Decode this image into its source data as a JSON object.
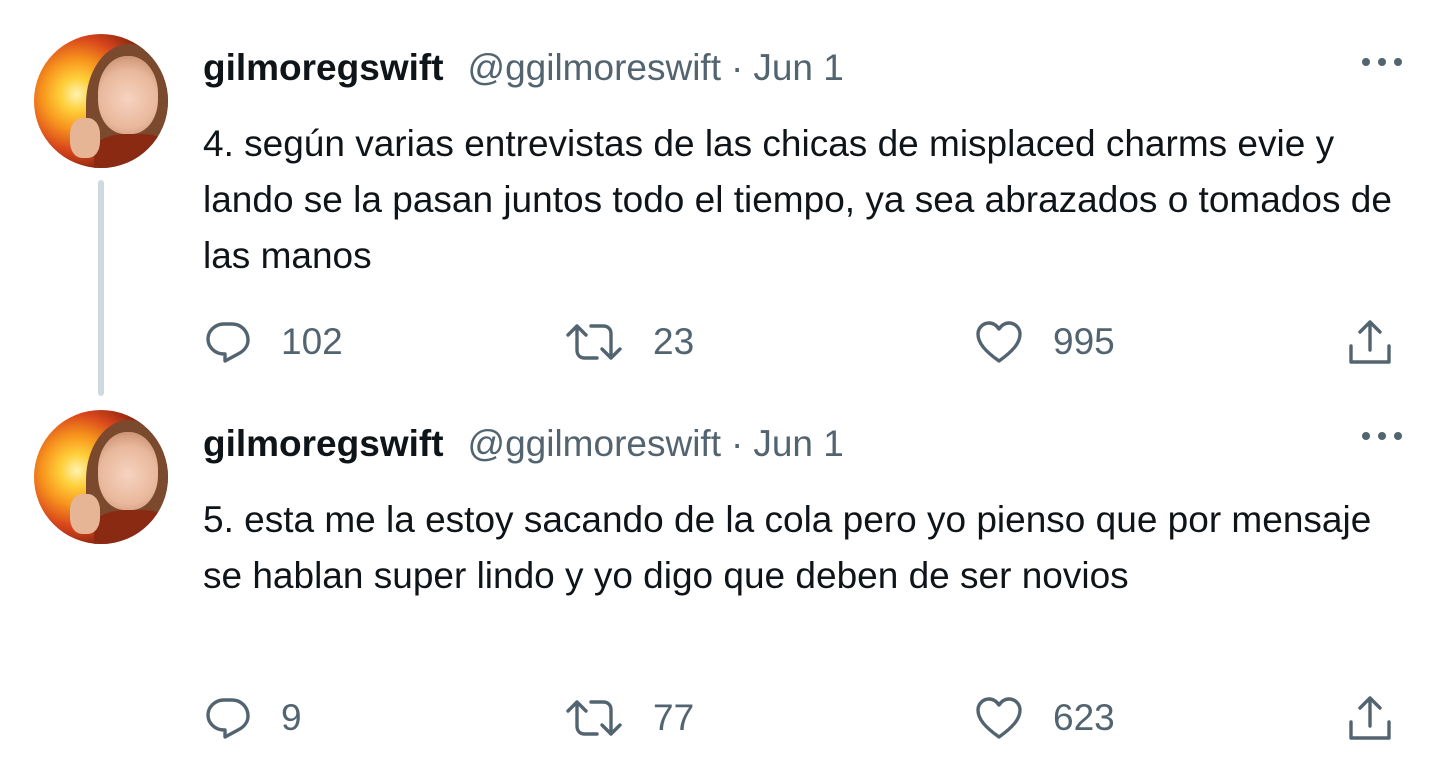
{
  "tweets": [
    {
      "author_name": "gilmoregswift",
      "author_handle": "@ggilmoreswift",
      "separator": "·",
      "date": "Jun 1",
      "text": "4. según varias entrevistas de las chicas de misplaced charms evie y lando se la pasan juntos todo el tiempo, ya sea abrazados o tomados de las manos",
      "replies": "102",
      "retweets": "23",
      "likes": "995"
    },
    {
      "author_name": "gilmoregswift",
      "author_handle": "@ggilmoreswift",
      "separator": "·",
      "date": "Jun 1",
      "text": "5. esta me la estoy sacando de la cola pero yo pienso que por mensaje se hablan super lindo y yo digo que deben de ser novios",
      "replies": "9",
      "retweets": "77",
      "likes": "623"
    }
  ],
  "icons": {
    "reply": "reply-icon",
    "retweet": "retweet-icon",
    "like": "heart-icon",
    "share": "share-icon",
    "more": "more-options-icon"
  },
  "colors": {
    "text_primary": "#0f1419",
    "text_secondary": "#536471",
    "thread_line": "#cfd9de",
    "background": "#ffffff"
  }
}
